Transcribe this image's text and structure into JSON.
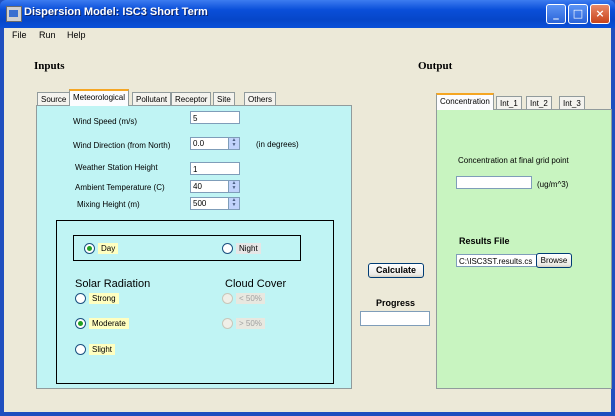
{
  "window": {
    "title": "Dispersion Model: ISC3 Short Term",
    "minimize": "_",
    "maximize": "□",
    "close": "×"
  },
  "menu": {
    "items": [
      "File",
      "Run",
      "Help"
    ]
  },
  "inputs": {
    "heading": "Inputs",
    "tabs": [
      "Source",
      "Meteorological",
      "Pollutant",
      "Receptor",
      "Site",
      "Others"
    ],
    "active_tab": "Meteorological",
    "fields": {
      "wind_speed": {
        "label": "Wind Speed (m/s)",
        "value": "5"
      },
      "wind_direction": {
        "label": "Wind Direction (from North)",
        "value": "0.0",
        "unit": "(in degrees)"
      },
      "station_height": {
        "label": "Weather Station Height",
        "value": "1"
      },
      "ambient_temp": {
        "label": "Ambient Temperature (C)",
        "value": "40"
      },
      "mixing_height": {
        "label": "Mixing Height (m)",
        "value": "500"
      }
    },
    "time_of_day": {
      "day": "Day",
      "night": "Night",
      "selected": "Day"
    },
    "solar_radiation": {
      "heading": "Solar Radiation",
      "options": [
        "Strong",
        "Moderate",
        "Slight"
      ],
      "selected": "Moderate"
    },
    "cloud_cover": {
      "heading": "Cloud Cover",
      "options": [
        "< 50%",
        "> 50%"
      ]
    }
  },
  "actions": {
    "calculate": "Calculate",
    "progress_label": "Progress"
  },
  "output": {
    "heading": "Output",
    "tabs": [
      "Concentration",
      "Int_1",
      "Int_2",
      "Int_3"
    ],
    "active_tab": "Concentration",
    "concentration_label": "Concentration at final grid point",
    "concentration_value": "",
    "concentration_unit": "(ug/m^3)",
    "results_heading": "Results File",
    "results_path": "C:\\ISC3ST.results.cs",
    "browse": "Browse"
  }
}
